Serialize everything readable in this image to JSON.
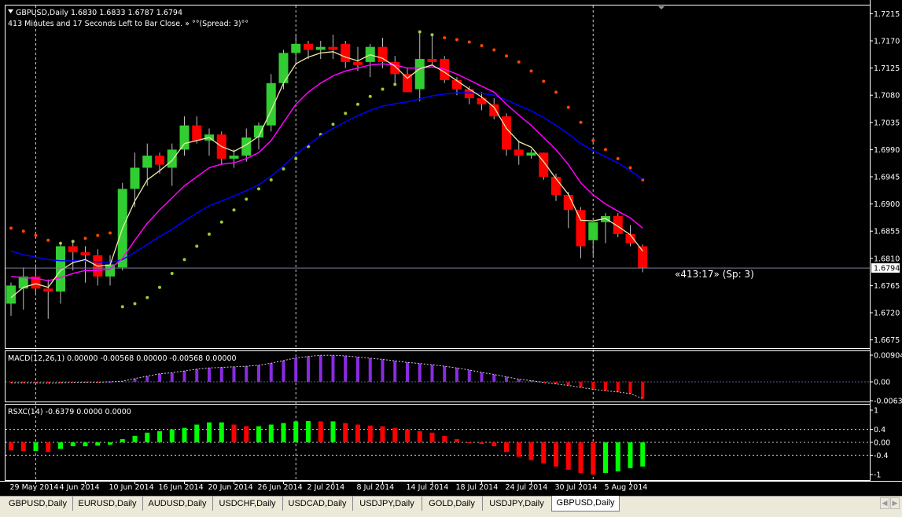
{
  "window": {
    "symbol_header": "GBPUSD,Daily  1.6830 1.6833 1.6787 1.6794",
    "timer_line": "413 Minutes and 17 Seconds Left to Bar Close. » °°(Spread: 3)°°",
    "timer_label": "«413:17» (Sp: 3)",
    "current_price": "1.6794"
  },
  "price_axis": {
    "labels": [
      "1.7215",
      "1.7170",
      "1.7125",
      "1.7080",
      "1.7035",
      "1.6990",
      "1.6945",
      "1.6900",
      "1.6855",
      "1.6810",
      "1.6765",
      "1.6720",
      "1.6675"
    ],
    "range": [
      1.6668,
      1.7222
    ]
  },
  "macd": {
    "label": "MACD(12,26,1) 0.00000 -0.00568 0.00000 -0.00568 0.00000",
    "axis_labels": [
      "0.00904",
      "0.00",
      "-0.00639"
    ]
  },
  "rsx": {
    "label": "RSXC(14) -0.6379 0.0000 0.0000",
    "axis_labels": [
      "1",
      "0.4",
      "0.00",
      "-0.4",
      "-1"
    ]
  },
  "time_axis": {
    "labels": [
      "29 May 2014",
      "4 Jun 2014",
      "10 Jun 2014",
      "16 Jun 2014",
      "20 Jun 2014",
      "26 Jun 2014",
      "2 Jul 2014",
      "8 Jul 2014",
      "14 Jul 2014",
      "18 Jul 2014",
      "24 Jul 2014",
      "30 Jul 2014",
      "5 Aug 2014"
    ]
  },
  "tabs": [
    {
      "label": "GBPUSD,Daily",
      "active": false
    },
    {
      "label": "EURUSD,Daily",
      "active": false
    },
    {
      "label": "AUDUSD,Daily",
      "active": false
    },
    {
      "label": "USDCHF,Daily",
      "active": false
    },
    {
      "label": "USDCAD,Daily",
      "active": false
    },
    {
      "label": "USDJPY,Daily",
      "active": false
    },
    {
      "label": "GOLD,Daily",
      "active": false
    },
    {
      "label": "USDJPY,Daily",
      "active": false
    },
    {
      "label": "GBPUSD,Daily",
      "active": true
    }
  ],
  "colors": {
    "bull": "#32cd32",
    "bear": "#ff0000",
    "fast_ma": "#eee8aa",
    "mid_ma": "#ff00ff",
    "slow_ma": "#0000ff",
    "sar_below": "#9acd32",
    "sar_above": "#ff4500",
    "macd_pos": "#8a2be2"
  },
  "chart_data": {
    "type": "candlestick",
    "candles": [
      {
        "o": 1.6735,
        "h": 1.677,
        "l": 1.6715,
        "c": 1.6765
      },
      {
        "o": 1.676,
        "h": 1.6795,
        "l": 1.6725,
        "c": 1.678
      },
      {
        "o": 1.678,
        "h": 1.68,
        "l": 1.675,
        "c": 1.676
      },
      {
        "o": 1.676,
        "h": 1.6775,
        "l": 1.671,
        "c": 1.6755
      },
      {
        "o": 1.6755,
        "h": 1.6835,
        "l": 1.6735,
        "c": 1.683
      },
      {
        "o": 1.683,
        "h": 1.684,
        "l": 1.679,
        "c": 1.682
      },
      {
        "o": 1.682,
        "h": 1.683,
        "l": 1.677,
        "c": 1.6815
      },
      {
        "o": 1.6815,
        "h": 1.6825,
        "l": 1.6765,
        "c": 1.678
      },
      {
        "o": 1.678,
        "h": 1.6815,
        "l": 1.6765,
        "c": 1.68
      },
      {
        "o": 1.6795,
        "h": 1.6935,
        "l": 1.679,
        "c": 1.6925
      },
      {
        "o": 1.6925,
        "h": 1.6985,
        "l": 1.6895,
        "c": 1.696
      },
      {
        "o": 1.696,
        "h": 1.7,
        "l": 1.693,
        "c": 1.698
      },
      {
        "o": 1.698,
        "h": 1.6985,
        "l": 1.695,
        "c": 1.6965
      },
      {
        "o": 1.696,
        "h": 1.7,
        "l": 1.693,
        "c": 1.699
      },
      {
        "o": 1.699,
        "h": 1.7045,
        "l": 1.698,
        "c": 1.703
      },
      {
        "o": 1.703,
        "h": 1.7045,
        "l": 1.7,
        "c": 1.7005
      },
      {
        "o": 1.7005,
        "h": 1.7025,
        "l": 1.698,
        "c": 1.7015
      },
      {
        "o": 1.7015,
        "h": 1.702,
        "l": 1.6965,
        "c": 1.6975
      },
      {
        "o": 1.6975,
        "h": 1.699,
        "l": 1.696,
        "c": 1.698
      },
      {
        "o": 1.698,
        "h": 1.7025,
        "l": 1.697,
        "c": 1.701
      },
      {
        "o": 1.701,
        "h": 1.7035,
        "l": 1.699,
        "c": 1.703
      },
      {
        "o": 1.703,
        "h": 1.7115,
        "l": 1.702,
        "c": 1.71
      },
      {
        "o": 1.71,
        "h": 1.7155,
        "l": 1.709,
        "c": 1.715
      },
      {
        "o": 1.715,
        "h": 1.718,
        "l": 1.713,
        "c": 1.7165
      },
      {
        "o": 1.7165,
        "h": 1.717,
        "l": 1.714,
        "c": 1.7155
      },
      {
        "o": 1.7155,
        "h": 1.717,
        "l": 1.714,
        "c": 1.716
      },
      {
        "o": 1.716,
        "h": 1.718,
        "l": 1.714,
        "c": 1.7155
      },
      {
        "o": 1.7165,
        "h": 1.717,
        "l": 1.7125,
        "c": 1.7135
      },
      {
        "o": 1.7135,
        "h": 1.716,
        "l": 1.712,
        "c": 1.713
      },
      {
        "o": 1.7135,
        "h": 1.7165,
        "l": 1.711,
        "c": 1.716
      },
      {
        "o": 1.716,
        "h": 1.7175,
        "l": 1.7125,
        "c": 1.7135
      },
      {
        "o": 1.7135,
        "h": 1.7145,
        "l": 1.71,
        "c": 1.7115
      },
      {
        "o": 1.7115,
        "h": 1.7125,
        "l": 1.7085,
        "c": 1.7085
      },
      {
        "o": 1.709,
        "h": 1.7185,
        "l": 1.707,
        "c": 1.714
      },
      {
        "o": 1.714,
        "h": 1.718,
        "l": 1.713,
        "c": 1.7135
      },
      {
        "o": 1.714,
        "h": 1.7145,
        "l": 1.71,
        "c": 1.7105
      },
      {
        "o": 1.7105,
        "h": 1.711,
        "l": 1.708,
        "c": 1.709
      },
      {
        "o": 1.709,
        "h": 1.7095,
        "l": 1.7065,
        "c": 1.7075
      },
      {
        "o": 1.7075,
        "h": 1.7085,
        "l": 1.7055,
        "c": 1.7065
      },
      {
        "o": 1.7065,
        "h": 1.7075,
        "l": 1.704,
        "c": 1.7045
      },
      {
        "o": 1.7045,
        "h": 1.705,
        "l": 1.698,
        "c": 1.699
      },
      {
        "o": 1.699,
        "h": 1.7005,
        "l": 1.6965,
        "c": 1.698
      },
      {
        "o": 1.698,
        "h": 1.699,
        "l": 1.6975,
        "c": 1.6985
      },
      {
        "o": 1.6985,
        "h": 1.6985,
        "l": 1.694,
        "c": 1.6945
      },
      {
        "o": 1.6945,
        "h": 1.695,
        "l": 1.6905,
        "c": 1.6915
      },
      {
        "o": 1.6915,
        "h": 1.692,
        "l": 1.686,
        "c": 1.689
      },
      {
        "o": 1.689,
        "h": 1.6895,
        "l": 1.681,
        "c": 1.683
      },
      {
        "o": 1.684,
        "h": 1.687,
        "l": 1.6815,
        "c": 1.687
      },
      {
        "o": 1.687,
        "h": 1.6885,
        "l": 1.6835,
        "c": 1.688
      },
      {
        "o": 1.688,
        "h": 1.6885,
        "l": 1.6845,
        "c": 1.685
      },
      {
        "o": 1.685,
        "h": 1.6865,
        "l": 1.683,
        "c": 1.6835
      },
      {
        "o": 1.683,
        "h": 1.6833,
        "l": 1.6787,
        "c": 1.6794
      }
    ],
    "ma_fast": [
      1.6745,
      1.6762,
      1.6768,
      1.6762,
      1.679,
      1.6803,
      1.6808,
      1.6797,
      1.6799,
      1.686,
      1.6905,
      1.694,
      1.6955,
      1.6972,
      1.7,
      1.7005,
      1.701,
      1.6995,
      1.6987,
      1.6998,
      1.7012,
      1.7055,
      1.71,
      1.7132,
      1.7143,
      1.715,
      1.7152,
      1.7143,
      1.7137,
      1.7147,
      1.7141,
      1.7128,
      1.7108,
      1.7124,
      1.713,
      1.7118,
      1.7104,
      1.709,
      1.7077,
      1.706,
      1.7025,
      1.7003,
      1.6994,
      1.697,
      1.6942,
      1.6916,
      1.6873,
      1.6872,
      1.6876,
      1.6863,
      1.6849,
      1.6822
    ],
    "ma_mid": [
      1.678,
      1.6778,
      1.6777,
      1.6773,
      1.6778,
      1.6785,
      1.679,
      1.679,
      1.6792,
      1.681,
      1.684,
      1.6868,
      1.689,
      1.691,
      1.693,
      1.6945,
      1.696,
      1.6966,
      1.6968,
      1.6975,
      1.6985,
      1.7005,
      1.7035,
      1.7065,
      1.7085,
      1.71,
      1.7112,
      1.712,
      1.7125,
      1.713,
      1.7132,
      1.713,
      1.7125,
      1.7125,
      1.7127,
      1.7123,
      1.7115,
      1.7105,
      1.7095,
      1.7085,
      1.7065,
      1.7047,
      1.703,
      1.701,
      1.699,
      1.6965,
      1.6935,
      1.6915,
      1.69,
      1.6888,
      1.6877,
      1.686
    ],
    "ma_slow": [
      1.6822,
      1.6816,
      1.6812,
      1.6808,
      1.6806,
      1.6806,
      1.6806,
      1.6804,
      1.6803,
      1.6808,
      1.682,
      1.6833,
      1.6846,
      1.6858,
      1.6872,
      1.6885,
      1.6897,
      1.6905,
      1.6913,
      1.6922,
      1.6932,
      1.6946,
      1.6963,
      1.6982,
      1.6998,
      1.7013,
      1.7025,
      1.7036,
      1.7046,
      1.7055,
      1.7062,
      1.7066,
      1.7069,
      1.7074,
      1.7079,
      1.7082,
      1.7084,
      1.7084,
      1.7083,
      1.708,
      1.7072,
      1.7063,
      1.7054,
      1.7043,
      1.703,
      1.7016,
      1.7,
      1.6988,
      1.6978,
      1.6968,
      1.6955,
      1.6941
    ],
    "sar": [
      1.686,
      1.6855,
      1.6848,
      1.684,
      1.6835,
      1.6838,
      1.6843,
      1.6848,
      1.6852,
      1.673,
      1.6735,
      1.6745,
      1.6762,
      1.6785,
      1.6808,
      1.683,
      1.685,
      1.687,
      1.689,
      1.6908,
      1.6925,
      1.694,
      1.6958,
      1.6975,
      1.6995,
      1.7015,
      1.7032,
      1.705,
      1.7065,
      1.7078,
      1.709,
      1.7098,
      1.7105,
      1.7185,
      1.718,
      1.7175,
      1.7172,
      1.7168,
      1.7162,
      1.7155,
      1.7145,
      1.7135,
      1.712,
      1.7103,
      1.7085,
      1.706,
      1.7035,
      1.7005,
      1.699,
      1.6975,
      1.696,
      1.694
    ],
    "macd_values": [
      -0.0003,
      -0.0003,
      -0.0003,
      -0.0004,
      -0.0003,
      -0.0002,
      -0.0001,
      -0.0001,
      0.0,
      0.0002,
      0.0011,
      0.0019,
      0.0027,
      0.0031,
      0.0037,
      0.0043,
      0.0047,
      0.0049,
      0.0051,
      0.0053,
      0.0056,
      0.0063,
      0.0072,
      0.0081,
      0.0086,
      0.009,
      0.009,
      0.0088,
      0.0084,
      0.008,
      0.0076,
      0.0071,
      0.0066,
      0.0062,
      0.0058,
      0.0053,
      0.0047,
      0.004,
      0.0032,
      0.0025,
      0.0017,
      0.0009,
      0.0004,
      -0.0002,
      -0.0007,
      -0.0012,
      -0.0019,
      -0.0025,
      -0.003,
      -0.0034,
      -0.004,
      -0.0057
    ],
    "rsx_values": [
      -0.25,
      -0.27,
      -0.27,
      -0.3,
      -0.2,
      -0.12,
      -0.12,
      -0.1,
      -0.07,
      0.1,
      0.2,
      0.3,
      0.35,
      0.4,
      0.45,
      0.55,
      0.62,
      0.62,
      0.55,
      0.5,
      0.5,
      0.55,
      0.6,
      0.65,
      0.66,
      0.65,
      0.65,
      0.6,
      0.55,
      0.52,
      0.5,
      0.45,
      0.4,
      0.35,
      0.3,
      0.2,
      0.1,
      0.0,
      -0.05,
      -0.12,
      -0.3,
      -0.45,
      -0.55,
      -0.65,
      -0.75,
      -0.85,
      -0.95,
      -1.0,
      -0.95,
      -0.9,
      -0.8,
      -0.75
    ]
  }
}
